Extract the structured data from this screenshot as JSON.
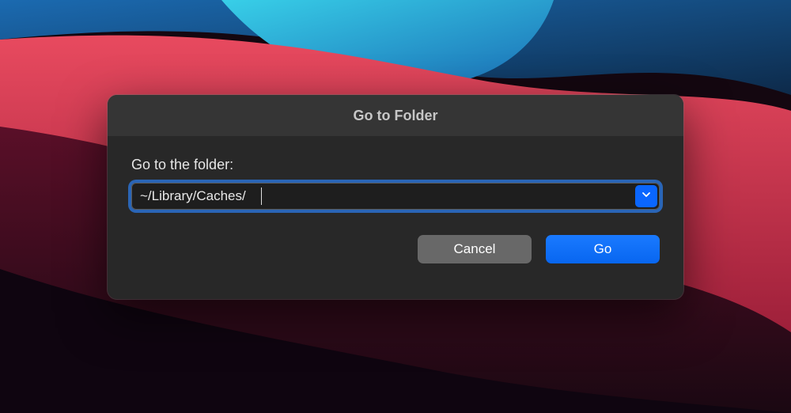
{
  "dialog": {
    "title": "Go to Folder",
    "label": "Go to the folder:",
    "input_value": "~/Library/Caches/",
    "cancel_label": "Cancel",
    "go_label": "Go"
  }
}
